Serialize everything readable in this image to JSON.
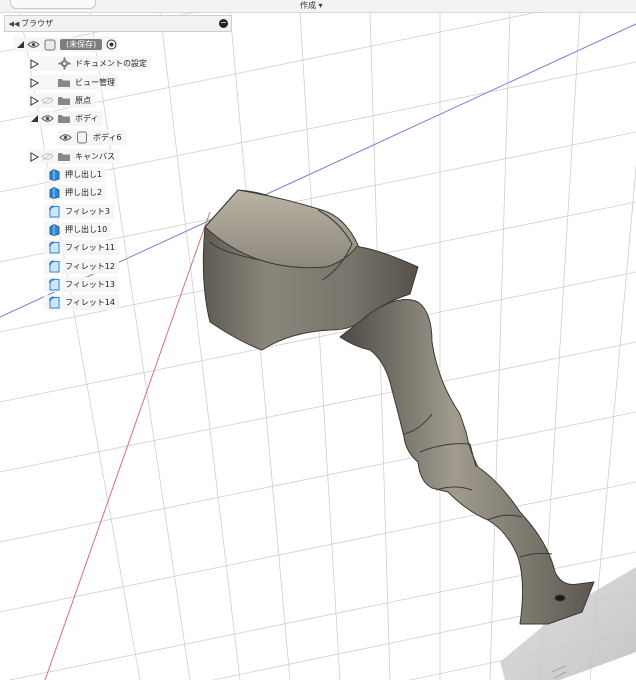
{
  "toolbar": {
    "create_menu": "作成 ▾"
  },
  "browser": {
    "title": "ブラウザ",
    "root": {
      "label": "(未保存)"
    },
    "nodes": [
      {
        "label": "ドキュメントの設定"
      },
      {
        "label": "ビュー管理"
      },
      {
        "label": "原点"
      },
      {
        "label": "ボディ"
      },
      {
        "label": "ボディ6"
      },
      {
        "label": "キャンバス"
      }
    ],
    "features": [
      {
        "label": "押し出し1",
        "icon": "extrude-icon"
      },
      {
        "label": "押し出し2",
        "icon": "extrude-icon"
      },
      {
        "label": "フィレット3",
        "icon": "fillet-icon"
      },
      {
        "label": "押し出し10",
        "icon": "extrude-icon"
      },
      {
        "label": "フィレット11",
        "icon": "fillet-icon"
      },
      {
        "label": "フィレット12",
        "icon": "fillet-icon"
      },
      {
        "label": "フィレット13",
        "icon": "fillet-icon"
      },
      {
        "label": "フィレット14",
        "icon": "fillet-icon"
      }
    ]
  },
  "colors": {
    "grid": "#c9c9c9",
    "x_axis": "#e07070",
    "y_axis": "#7b7bd8",
    "model_light": "#a8a395",
    "model_dark": "#4a4843",
    "accent_blue": "#2f87d1"
  }
}
